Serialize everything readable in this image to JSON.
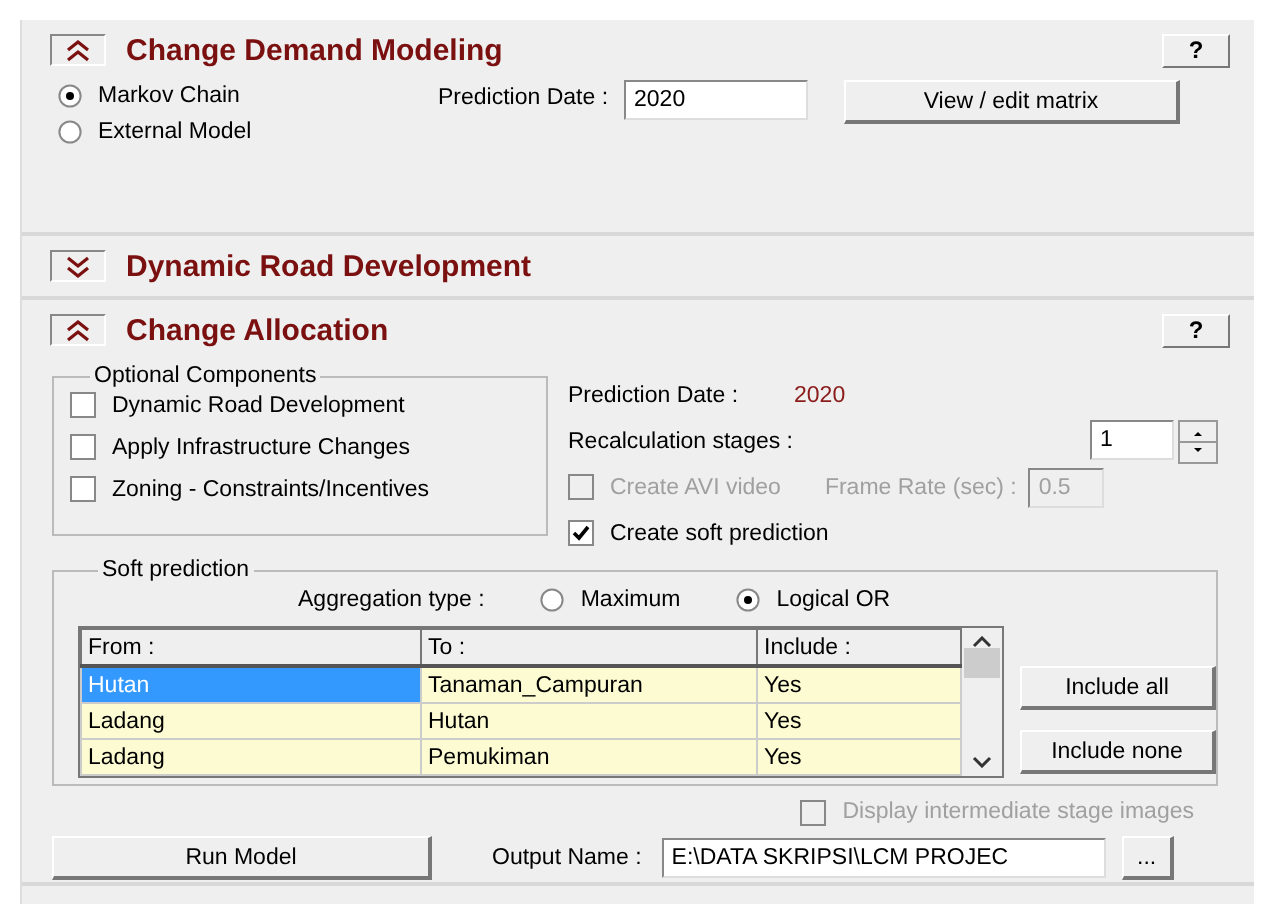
{
  "sections": [
    {
      "kind": "demand",
      "title": "Change Demand Modeling",
      "expanded": true,
      "help": "?",
      "methods": [
        {
          "label": "Markov Chain",
          "selected": true
        },
        {
          "label": "External Model",
          "selected": false
        }
      ],
      "prediction_date_label": "Prediction Date :",
      "prediction_date": "2020",
      "matrix_button": "View / edit matrix"
    },
    {
      "kind": "road",
      "title": "Dynamic Road Development",
      "expanded": false
    },
    {
      "kind": "allocation",
      "title": "Change Allocation",
      "expanded": true,
      "help": "?",
      "optional_components": {
        "title": "Optional Components",
        "items": [
          {
            "label": "Dynamic Road Development",
            "checked": false
          },
          {
            "label": "Apply Infrastructure Changes",
            "checked": false
          },
          {
            "label": "Zoning - Constraints/Incentives",
            "checked": false
          }
        ]
      },
      "prediction_date_label": "Prediction Date :",
      "prediction_date": "2020",
      "recalc_label": "Recalculation stages :",
      "recalc_value": "1",
      "create_avi": {
        "label": "Create AVI video",
        "checked": false,
        "disabled": true
      },
      "frame_rate_label": "Frame Rate  (sec) :",
      "frame_rate": "0.5",
      "create_soft": {
        "label": "Create soft prediction",
        "checked": true,
        "disabled": false
      },
      "soft_prediction": {
        "title": "Soft prediction",
        "aggregation_label": "Aggregation type :",
        "options": [
          {
            "label": "Maximum",
            "selected": false
          },
          {
            "label": "Logical OR",
            "selected": true
          }
        ],
        "table": {
          "columns": [
            "From :",
            "To :",
            "Include :"
          ],
          "rows": [
            {
              "cells": [
                "Hutan",
                "Tanaman_Campuran",
                "Yes"
              ],
              "selected": true
            },
            {
              "cells": [
                "Ladang",
                "Hutan",
                "Yes"
              ],
              "selected": false
            },
            {
              "cells": [
                "Ladang",
                "Pemukiman",
                "Yes"
              ],
              "selected": false
            }
          ]
        },
        "buttons": [
          "Include all",
          "Include none"
        ]
      },
      "display_intermediate": {
        "label": "Display intermediate stage images",
        "checked": false,
        "disabled": true
      },
      "run_button": "Run Model",
      "output_label": "Output Name :",
      "output_value": "E:\\DATA SKRIPSI\\LCM PROJEC",
      "browse_button": "..."
    }
  ]
}
